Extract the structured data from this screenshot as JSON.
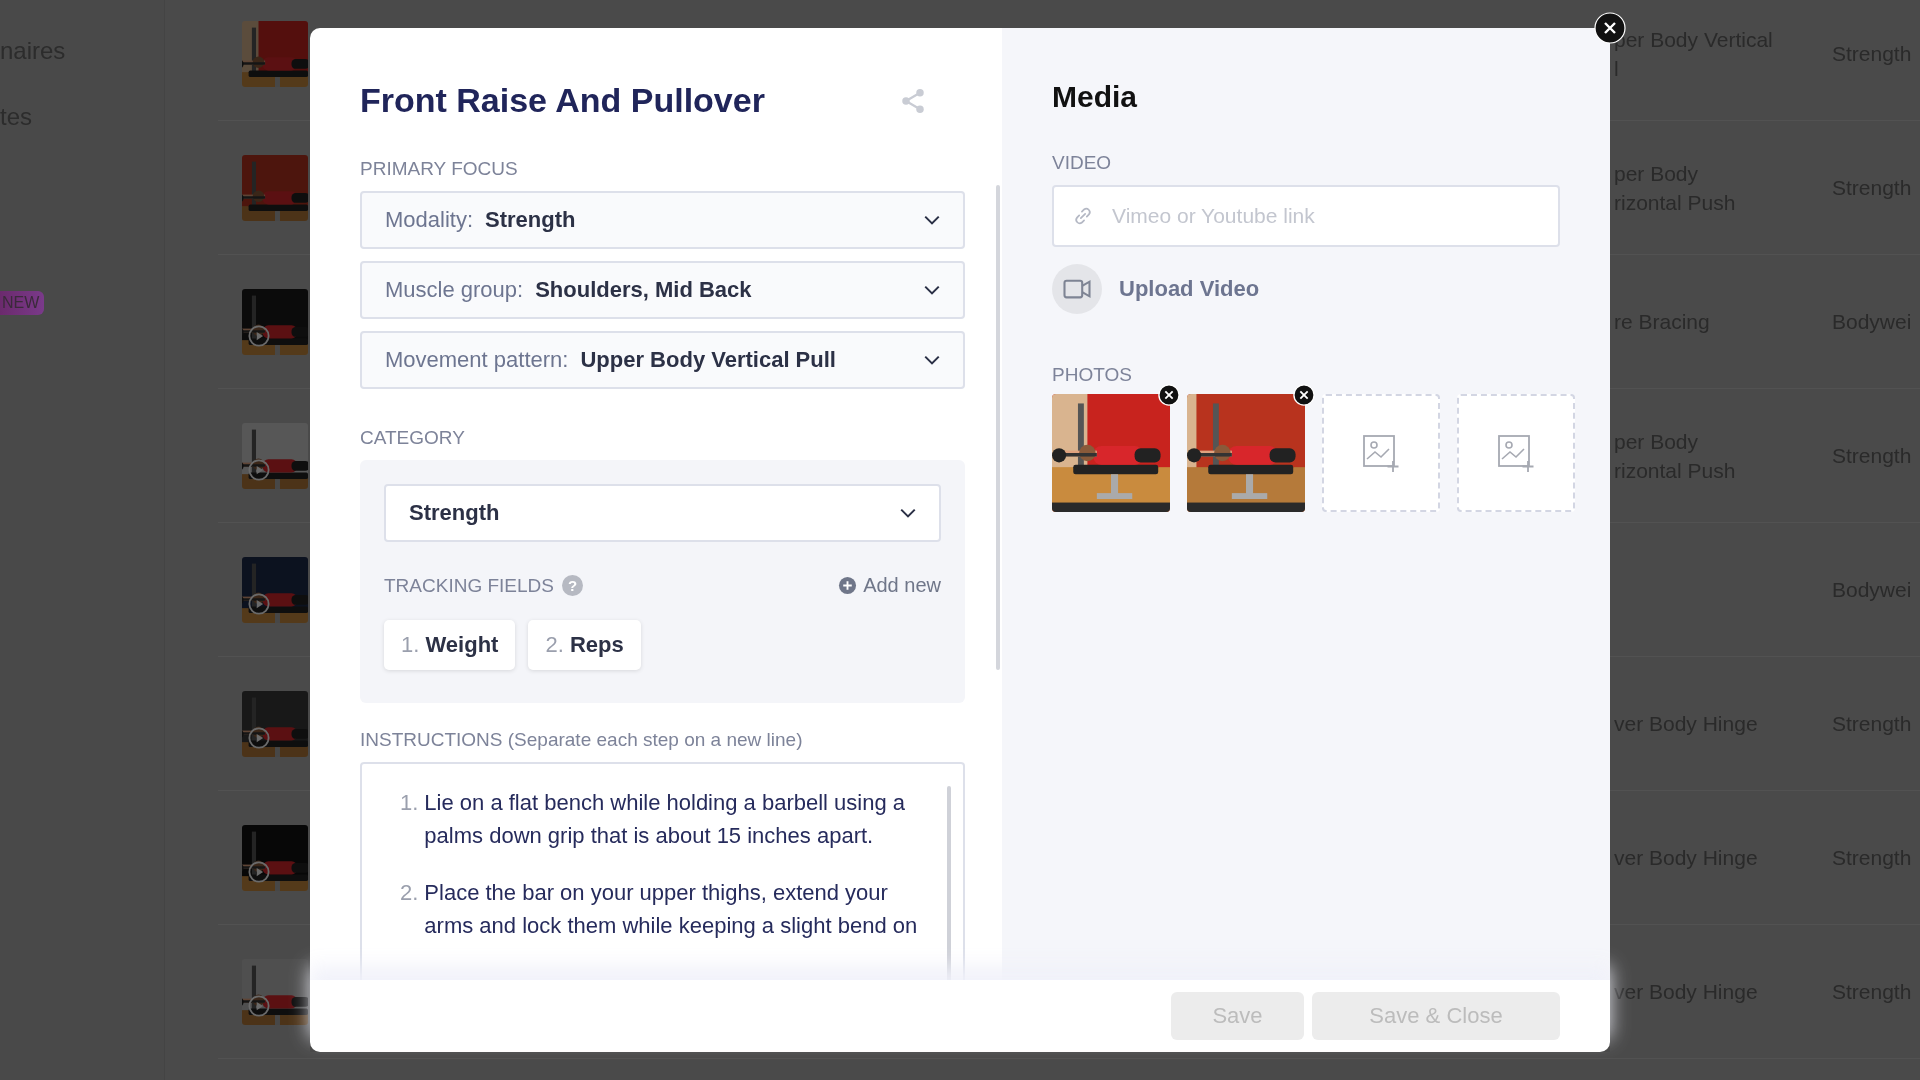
{
  "sidebar": {
    "items": [
      {
        "label": "naires"
      },
      {
        "label": "tes"
      }
    ],
    "badge": "NEW"
  },
  "exercises": [
    {
      "thumbnail": {
        "kind": "picture",
        "video": false
      },
      "movement": [
        "per Body Vertical",
        "l"
      ],
      "modality": "Strength"
    },
    {
      "thumbnail": {
        "kind": "picture",
        "video": false
      },
      "movement": [
        "per Body",
        "rizontal Push"
      ],
      "modality": "Strength"
    },
    {
      "thumbnail": {
        "kind": "picture",
        "video": true
      },
      "movement": [
        "re Bracing"
      ],
      "modality": "Bodywei"
    },
    {
      "thumbnail": {
        "kind": "picture",
        "video": true
      },
      "movement": [
        "per Body",
        "rizontal Push"
      ],
      "modality": "Strength"
    },
    {
      "thumbnail": {
        "kind": "picture",
        "video": true
      },
      "modality": "Bodywei"
    },
    {
      "thumbnail": {
        "kind": "picture",
        "video": true
      },
      "movement": [
        "ver Body Hinge"
      ],
      "modality": "Strength"
    },
    {
      "thumbnail": {
        "kind": "picture",
        "video": true
      },
      "movement": [
        "ver Body Hinge"
      ],
      "modality": "Strength"
    },
    {
      "thumbnail": {
        "kind": "picture",
        "video": true
      },
      "movement": [
        "ver Body Hinge"
      ],
      "modality": "Strength"
    }
  ],
  "modal": {
    "title": "Front Raise And Pullover",
    "primary_focus": {
      "label": "PRIMARY FOCUS",
      "selects": [
        {
          "label": "Modality:",
          "value": "Strength"
        },
        {
          "label": "Muscle group:",
          "value": "Shoulders, Mid Back"
        },
        {
          "label": "Movement pattern:",
          "value": "Upper Body Vertical Pull"
        }
      ]
    },
    "category": {
      "label": "CATEGORY",
      "value": "Strength"
    },
    "tracking_fields": {
      "label": "TRACKING FIELDS",
      "help": "?",
      "add_label": "Add new",
      "items": [
        {
          "number": "1.",
          "name": "Weight"
        },
        {
          "number": "2.",
          "name": "Reps"
        }
      ]
    },
    "instructions": {
      "label": "INSTRUCTIONS (Separate each step on a new line)",
      "steps": [
        {
          "number": "1.",
          "text": "Lie on a flat bench while holding a barbell using a palms down grip that is about 15 inches apart."
        },
        {
          "number": "2.",
          "text": "Place the bar on your upper thighs, extend your arms and lock them while keeping a slight bend on"
        }
      ]
    },
    "media": {
      "title": "Media",
      "video_label": "VIDEO",
      "video_placeholder": "Vimeo or Youtube link",
      "upload_label": "Upload Video",
      "photos_label": "PHOTOS",
      "photos": [
        {
          "kind": "picture"
        },
        {
          "kind": "picture"
        },
        {
          "kind": "empty"
        },
        {
          "kind": "empty"
        }
      ]
    },
    "buttons": [
      {
        "label": "Save",
        "disabled": true
      },
      {
        "label": "Save & Close",
        "disabled": true
      }
    ]
  }
}
